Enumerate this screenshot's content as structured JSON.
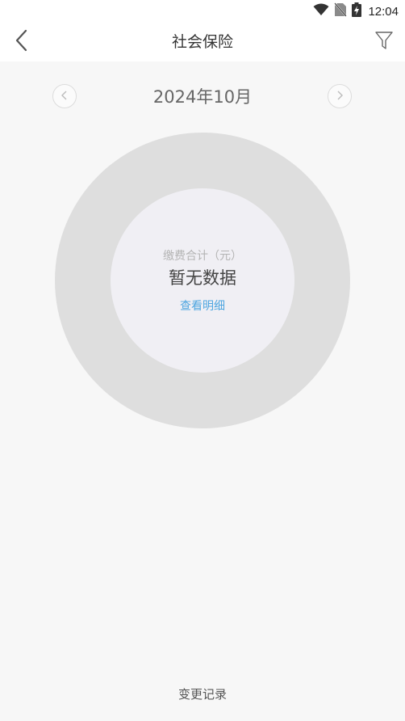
{
  "status_bar": {
    "time": "12:04",
    "icons": [
      "wifi-icon",
      "no-sim-icon",
      "battery-charging-icon"
    ]
  },
  "nav": {
    "back_icon": "chevron-left-icon",
    "title": "社会保险",
    "filter_icon": "filter-funnel-icon"
  },
  "month_selector": {
    "label": "2024年10月",
    "prev_icon": "chevron-left-circle-icon",
    "next_icon": "chevron-right-circle-icon"
  },
  "summary": {
    "total_label": "缴费合计（元）",
    "value": "暂无数据",
    "detail_link": "查看明细"
  },
  "footer": {
    "change_record": "变更记录"
  },
  "colors": {
    "donut_ring": "#dedede",
    "donut_center": "#f0eff4",
    "link": "#4ea6e0",
    "background": "#f7f7f7"
  }
}
